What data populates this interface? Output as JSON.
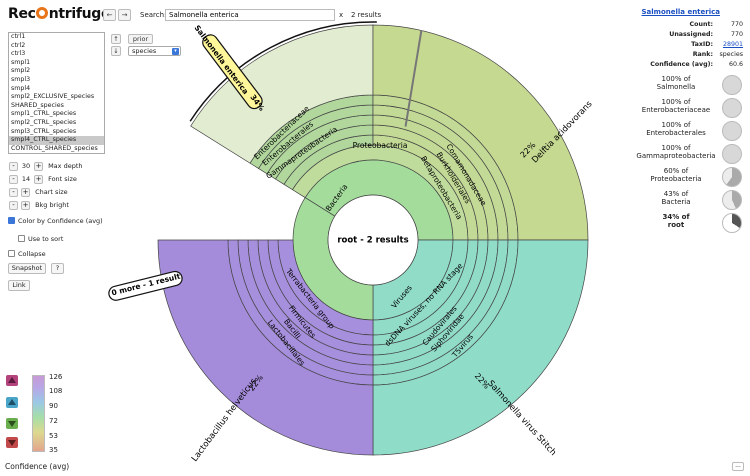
{
  "app": {
    "title_a": "Rec",
    "title_b": "ntrifuge"
  },
  "nav": {
    "back": "←",
    "forward": "→"
  },
  "search": {
    "label": "Search:",
    "value": "Salmonella enterica",
    "clear": "x",
    "results": "2 results"
  },
  "datasets": [
    "ctrl1",
    "ctrl2",
    "ctrl3",
    "smpl1",
    "smpl2",
    "smpl3",
    "smpl4",
    "smpl2_EXCLUSIVE_species",
    "SHARED_species",
    "smpl1_CTRL_species",
    "smpl2_CTRL_species",
    "smpl3_CTRL_species",
    "smpl4_CTRL_species",
    "CONTROL_SHARED_species"
  ],
  "selected_dataset": "smpl4_CTRL_species",
  "rank_controls": {
    "up": "↑",
    "down": "↓",
    "prior": "prior",
    "rank": "species"
  },
  "controls": {
    "max_depth": {
      "minus": "-",
      "value": "30",
      "plus": "+",
      "label": "Max depth"
    },
    "font_size": {
      "minus": "-",
      "value": "14",
      "plus": "+",
      "label": "Font size"
    },
    "chart_size": {
      "minus": "-",
      "plus": "+",
      "label": "Chart size"
    },
    "bkg_bright": {
      "minus": "-",
      "plus": "+",
      "label": "Bkg bright"
    }
  },
  "options": {
    "color_by": "Color by Confidence (avg)",
    "use_to_sort": "Use to sort",
    "collapse": "Collapse"
  },
  "buttons": {
    "snapshot": "Snapshot",
    "help": "?",
    "link": "Link"
  },
  "info": {
    "name": "Salmonella enterica",
    "rows": [
      {
        "k": "Count:",
        "v": "770"
      },
      {
        "k": "Unassigned:",
        "v": "770"
      },
      {
        "k": "TaxID:",
        "v": "28901"
      },
      {
        "k": "Rank:",
        "v": "species"
      },
      {
        "k": "Confidence (avg):",
        "v": "60.6"
      }
    ]
  },
  "hierarchy": [
    {
      "pct": "100% of",
      "name": "Salmonella",
      "frac": 1.0,
      "bold": false
    },
    {
      "pct": "100% of",
      "name": "Enterobacteriaceae",
      "frac": 1.0,
      "bold": false
    },
    {
      "pct": "100% of",
      "name": "Enterobacterales",
      "frac": 1.0,
      "bold": false
    },
    {
      "pct": "100% of",
      "name": "Gammaproteobacteria",
      "frac": 1.0,
      "bold": false
    },
    {
      "pct": "60% of",
      "name": "Proteobacteria",
      "frac": 0.6,
      "bold": false
    },
    {
      "pct": "43% of",
      "name": "Bacteria",
      "frac": 0.43,
      "bold": false
    },
    {
      "pct": "34% of",
      "name": "root",
      "frac": 0.34,
      "bold": true
    }
  ],
  "legend": {
    "ticks": [
      "126",
      "108",
      "90",
      "72",
      "53",
      "35"
    ],
    "title": "Confidence (avg)"
  },
  "more": "...",
  "chart": {
    "center": "root - 2 results",
    "bacteria": "Bacteria",
    "viruses": "Viruses",
    "proteobacteria": "Proteobacteria",
    "gamma": "Gammaproteobacteria",
    "enterobacterales": "Enterobacterales",
    "enterobacteriaceae": "Enterobacteriaceae",
    "betaproteo": "Betaproteobacteria",
    "burkholderiales": "Burkholderiales",
    "comamonadaceae": "Comamonadaceae",
    "terrabacteria": "Terrabacteria group",
    "firmicutes": "Firmicutes",
    "bacilli": "Bacilli",
    "lactobacillales": "Lactobacillales",
    "dsdna": "dsDNA viruses, no RNA stage",
    "caudovirales": "Caudovirales",
    "siphoviridae": "Siphoviridae",
    "t5virus": "T5virus",
    "salmonella_label": "Salmonella enterica",
    "salmonella_pct": "34%",
    "delftia": "Delftia acidovorans",
    "delftia_pct": "22%",
    "lactobacillus": "Lactobacillus helveticus",
    "lactobacillus_pct": "22%",
    "phage": "Salmonella virus Stitch",
    "phage_pct": "22%",
    "more_label": "0 more - 1 result",
    "colors": {
      "salmonella": "#e1ecd0",
      "delftia": "#c5d991",
      "lacto": "#a58cdb",
      "phage": "#8fdcc8",
      "bacteria": "#a4dc9c",
      "gamma": "#b1d79d",
      "proteo": "#bfdc9c",
      "beta": "#c3da96",
      "terra": "#a68fdc",
      "virus": "#90dcc7"
    }
  }
}
